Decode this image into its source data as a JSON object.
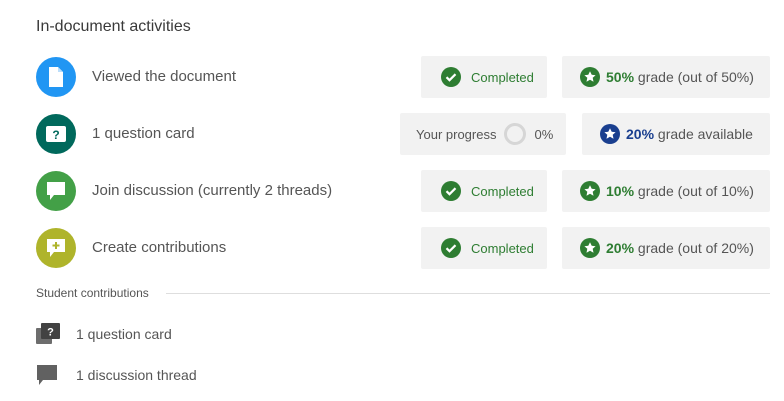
{
  "section_title": "In-document activities",
  "activities": [
    {
      "label": "Viewed the document",
      "icon": "document-icon",
      "icon_color": "#2196f3",
      "status": "Completed",
      "grade_pct": "50%",
      "grade_text": "grade (out of 50%)"
    },
    {
      "label": "1 question card",
      "icon": "question-card-icon",
      "icon_color": "#00695c",
      "progress_label": "Your progress",
      "progress_pct": "0%",
      "grade_pct": "20%",
      "grade_text": "grade available"
    },
    {
      "label": "Join discussion (currently 2 threads)",
      "icon": "discussion-icon",
      "icon_color": "#43a047",
      "status": "Completed",
      "grade_pct": "10%",
      "grade_text": "grade (out of 10%)"
    },
    {
      "label": "Create contributions",
      "icon": "add-contribution-icon",
      "icon_color": "#afb42b",
      "status": "Completed",
      "grade_pct": "20%",
      "grade_text": "grade (out of 20%)"
    }
  ],
  "contributions_title": "Student contributions",
  "contributions": [
    {
      "label": "1 question card",
      "icon": "question-cards-icon"
    },
    {
      "label": "1 discussion thread",
      "icon": "chat-bubble-icon"
    }
  ],
  "colors": {
    "completed_green": "#2e7d32",
    "available_blue": "#1a3f8f",
    "chip_bg": "#f2f2f2"
  }
}
